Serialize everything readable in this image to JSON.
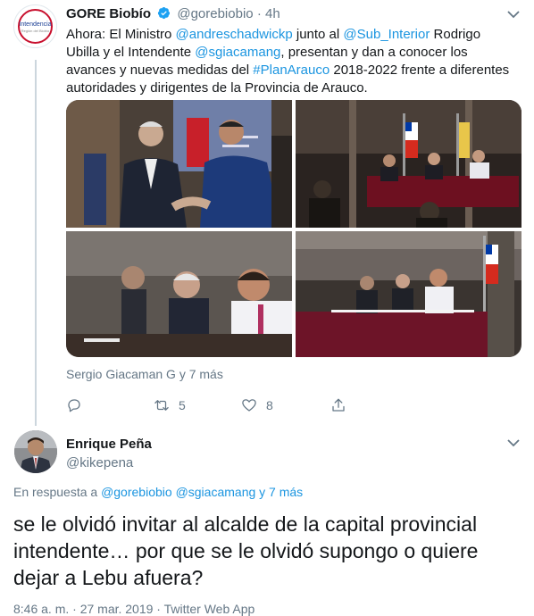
{
  "tweet": {
    "author_name": "GORE Biobío",
    "author_handle": "@gorebiobio",
    "separator": "·",
    "time": "4h",
    "avatar_text": "Intendencia",
    "avatar_subtext": "Región del Biobío",
    "text_parts": [
      {
        "t": "Ahora: El Ministro ",
        "link": false
      },
      {
        "t": "@andreschadwickp",
        "link": true
      },
      {
        "t": " junto al ",
        "link": false
      },
      {
        "t": "@Sub_Interior",
        "link": true
      },
      {
        "t": " Rodrigo Ubilla y el Intendente ",
        "link": false
      },
      {
        "t": "@sgiacamang",
        "link": true
      },
      {
        "t": ", presentan y dan a conocer los avances y nuevas medidas del ",
        "link": false
      },
      {
        "t": "#PlanArauco",
        "link": true
      },
      {
        "t": " 2018-2022 frente a diferentes autoridades y dirigentes de la Provincia de Arauco.",
        "link": false
      }
    ],
    "tagged": "Sergio Giacaman G y 7 más",
    "reply_count": "",
    "retweet_count": "5",
    "like_count": "8"
  },
  "reply": {
    "author_name": "Enrique Peña",
    "author_handle": "@kikepena",
    "in_reply_to_prefix": "En respuesta a ",
    "in_reply_to_1": "@gorebiobio",
    "in_reply_to_2": "@sgiacamang",
    "in_reply_to_more": "y 7 más",
    "text": "se le olvidó invitar al alcalde de la capital provincial intendente… por que se le olvidó supongo o quiere dejar a Lebu afuera?",
    "meta": "8:46 a. m. · 27 mar. 2019 · Twitter Web App"
  },
  "colors": {
    "link": "#1b95e0",
    "secondary": "#657786",
    "text": "#14171a",
    "thread_line": "#ccd6dd"
  }
}
